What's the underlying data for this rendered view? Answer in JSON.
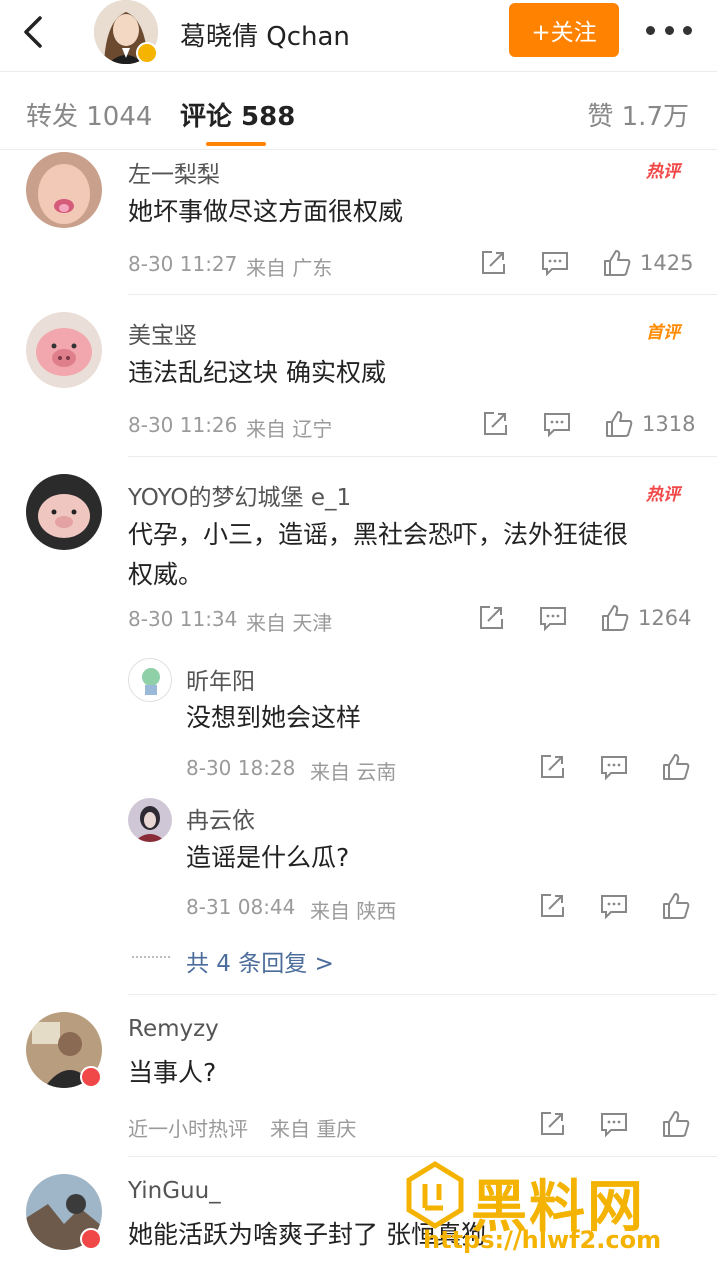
{
  "header": {
    "back_icon": "chevron-left-icon",
    "user_name": "葛晓倩 Qchan",
    "follow_label": "+关注",
    "more_icon": "more-horizontal-icon",
    "brand_color": "#ff8200"
  },
  "tabs": {
    "forward": "转发 1044",
    "comments": "评论 588",
    "likes": "赞 1.7万"
  },
  "comments": [
    {
      "name": "左一梨梨",
      "text": "她坏事做尽这方面很权威",
      "time": "8-30 11:27",
      "from": "来自 广东",
      "likes": "1425",
      "tag": "热评"
    },
    {
      "name": "美宝竖",
      "text": "违法乱纪这块 确实权威",
      "time": "8-30 11:26",
      "from": "来自 辽宁",
      "likes": "1318",
      "tag": "首评"
    },
    {
      "name": "YOYO的梦幻城堡 e_1",
      "text_line1": "代孕，小三，造谣，黑社会恐吓，法外狂徒很",
      "text_line2": "权威。",
      "time": "8-30 11:34",
      "from": "来自 天津",
      "likes": "1264",
      "tag": "热评",
      "replies": [
        {
          "name": "昕年阳",
          "text": "没想到她会这样",
          "time": "8-30 18:28",
          "from": "来自 云南"
        },
        {
          "name": "冉云依",
          "text": "造谣是什么瓜?",
          "time": "8-31 08:44",
          "from": "来自 陕西"
        }
      ],
      "more_replies": "共 4 条回复 >"
    },
    {
      "name": "Remyzy",
      "text": "当事人?",
      "time": "近一小时热评",
      "from": "来自 重庆"
    },
    {
      "name": "YinGuu_",
      "text": "她能活跃为啥爽子封了 张恒真狗"
    }
  ],
  "watermark": {
    "text": "黑料网",
    "url": "https://hlwf2.com"
  }
}
